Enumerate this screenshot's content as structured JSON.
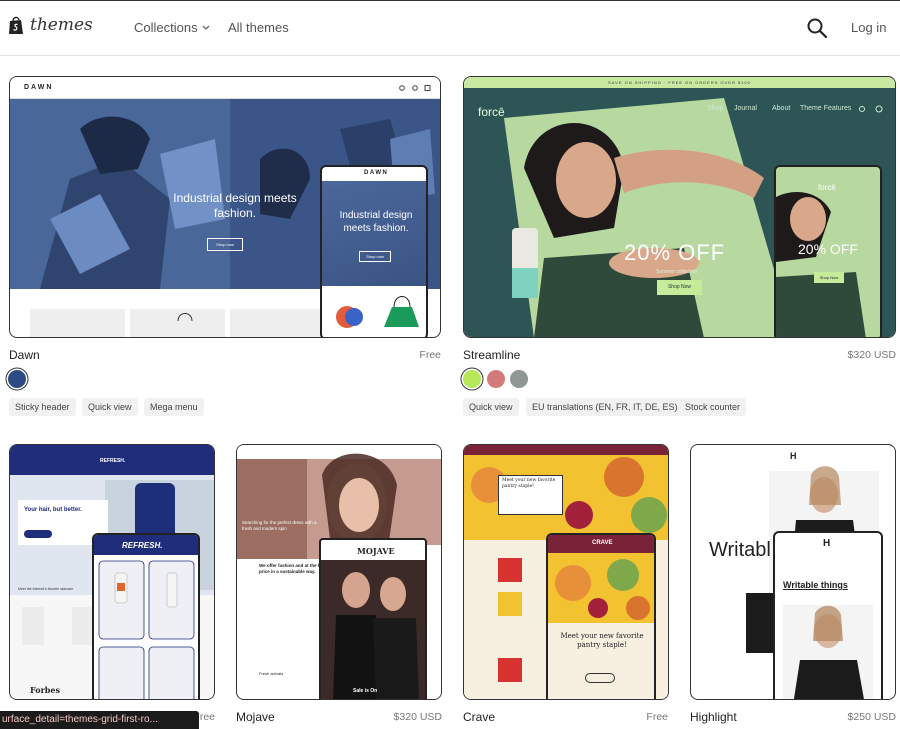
{
  "header": {
    "logo_text": "themes",
    "nav_collections": "Collections",
    "nav_all_themes": "All themes",
    "login": "Log in"
  },
  "row1": [
    {
      "name": "Dawn",
      "price": "Free",
      "swatches": [
        "#2e4a83"
      ],
      "tags": [
        "Sticky header",
        "Quick view",
        "Mega menu"
      ],
      "preview": {
        "logo": "DAWN",
        "headline": "Industrial design meets fashion.",
        "button": "Shop now"
      }
    },
    {
      "name": "Streamline",
      "price": "$320 USD",
      "swatches": [
        "#b6e85a",
        "#d27a7a",
        "#8f9693"
      ],
      "tags": [
        "Quick view",
        "EU translations (EN, FR, IT, DE, ES)",
        "Stock counter"
      ],
      "preview": {
        "banner": "SAVE ON SHIPPING · FREE ON ORDERS OVER $100",
        "logo": "forcē",
        "menu": [
          "Shop",
          "Journal",
          "About",
          "Theme Features"
        ],
        "headline": "20% OFF",
        "subline": "Summer collection",
        "button": "Shop Now"
      }
    }
  ],
  "row2": [
    {
      "name": "",
      "price": "Free",
      "preview": {
        "logo": "REFRESH.",
        "headline": "Your hair, but better.",
        "caption": "Meet the internet's favorite skincare",
        "brand": "Forbes"
      }
    },
    {
      "name": "Mojave",
      "price": "$320 USD",
      "preview": {
        "logo": "MOJAVE",
        "headline": "Searching for the perfect dress with a fresh and modern spin",
        "text": "We offer fashion and at the best price in a sustainable way.",
        "sale": "Sale is On",
        "section": "Fresh arrivals"
      }
    },
    {
      "name": "Crave",
      "price": "Free",
      "preview": {
        "headline": "Meet your new favorite pantry staple!",
        "logo": "CRAVE"
      }
    },
    {
      "name": "Highlight",
      "price": "$250 USD",
      "preview": {
        "logo": "H",
        "headline": "Writable things",
        "big": "Writabl"
      }
    }
  ],
  "status_url": "urface_detail=themes-grid-first-ro..."
}
